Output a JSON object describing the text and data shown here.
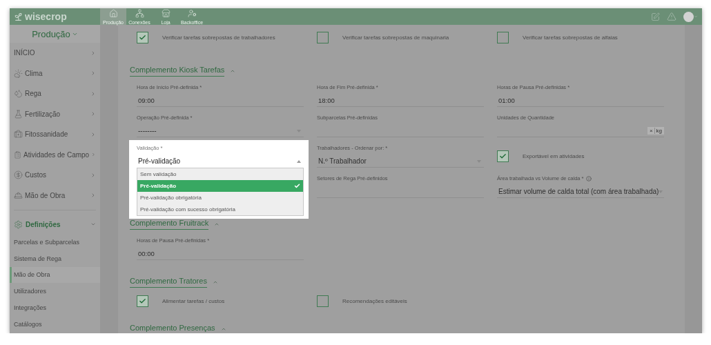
{
  "header": {
    "logo": "wisecrop",
    "nav_tabs": [
      {
        "label": "Produção",
        "selected": true
      },
      {
        "label": "Conexões",
        "selected": false
      },
      {
        "label": "Loja",
        "selected": false
      },
      {
        "label": "Backoffice",
        "selected": false
      }
    ]
  },
  "sidebar": {
    "module": "Produção",
    "items": [
      {
        "label": "INÍCIO"
      },
      {
        "label": "Clima"
      },
      {
        "label": "Rega"
      },
      {
        "label": "Fertilização"
      },
      {
        "label": "Fitossanidade"
      },
      {
        "label": "Atividades de Campo"
      },
      {
        "label": "Custos"
      },
      {
        "label": "Mão de Obra"
      }
    ],
    "settings": {
      "label": "Definições",
      "expanded": true,
      "children": [
        {
          "label": "Parcelas e Subparcelas",
          "selected": false
        },
        {
          "label": "Sistema de Rega",
          "selected": false
        },
        {
          "label": "Mão de Obra",
          "selected": true
        },
        {
          "label": "Utilizadores",
          "selected": false
        },
        {
          "label": "Integrações",
          "selected": false
        },
        {
          "label": "Catálogos",
          "selected": false
        }
      ]
    }
  },
  "top_checks": [
    {
      "label": "Verificar tarefas sobrepostas de trabalhadores",
      "checked": true
    },
    {
      "label": "Verificar tarefas sobrepostas de maquinaria",
      "checked": false
    },
    {
      "label": "Verificar tarefas sobrepostas de alfaias",
      "checked": false
    }
  ],
  "sections": [
    {
      "title": "Complemento Kiosk Tarefas",
      "expanded": true,
      "fields": [
        {
          "kind": "text",
          "label": "Hora de Início Pré-definida *",
          "value": "09:00"
        },
        {
          "kind": "text",
          "label": "Hora de Fim Pré-definida *",
          "value": "18:00"
        },
        {
          "kind": "text",
          "label": "Horas de Pausa Pré-definidas *",
          "value": "01:00"
        },
        {
          "kind": "select",
          "label": "Operação Pré-definida *",
          "value": "--------",
          "open": false
        },
        {
          "kind": "text",
          "label": "Subparcelas Pré-definidas"
        },
        {
          "kind": "chips",
          "label": "Unidades de Quantidade",
          "chips": [
            {
              "remove": "×",
              "label": "kg"
            }
          ]
        },
        {
          "kind": "select",
          "label": "Validação *",
          "value": "Pré-validação",
          "open": true,
          "options": [
            {
              "label": "Sem validação",
              "selected": false
            },
            {
              "label": "Pré-validação",
              "selected": true
            },
            {
              "label": "Pré-validação obrigatória",
              "selected": false
            },
            {
              "label": "Pré-validação com sucesso obrigatória",
              "selected": false
            }
          ]
        },
        {
          "kind": "select",
          "label": "Trabalhadores - Ordenar por: *",
          "value": "N.º Trabalhador",
          "open": false
        },
        {
          "kind": "checkbox",
          "label": "Exportável em atividades",
          "checked": true
        },
        {
          "kind": "text",
          "label": "Setores de Rega Pré-definidos"
        },
        {
          "kind": "select",
          "label": "Área trabalhada vs Volume de calda *",
          "info": true,
          "value": "Estimar volume de calda total (com área trabalhada)",
          "open": false
        }
      ]
    },
    {
      "title": "Complemento Fruitrack",
      "expanded": true,
      "fields": [
        {
          "kind": "text",
          "label": "Horas de Pausa Pré-definidas *",
          "value": "00:00"
        }
      ]
    },
    {
      "title": "Complemento Tratores",
      "expanded": true,
      "fields": [
        {
          "kind": "checkbox",
          "label": "Alimentar tarefas / custos",
          "checked": true
        },
        {
          "kind": "checkbox",
          "label": "Recomendações editáveis",
          "checked": false
        }
      ]
    },
    {
      "title": "Complemento Presenças",
      "expanded": true
    }
  ]
}
